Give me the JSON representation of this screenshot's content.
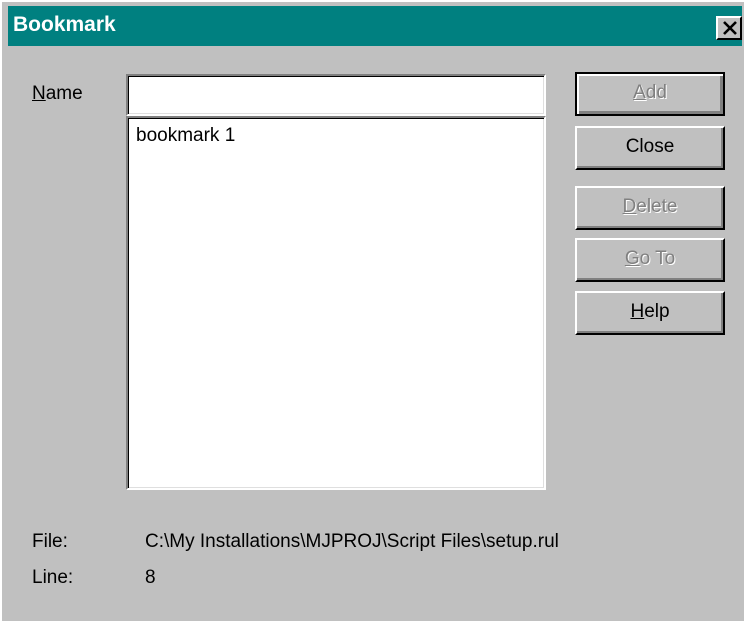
{
  "window": {
    "title": "Bookmark",
    "close_icon": "close-x-icon"
  },
  "form": {
    "name_label_mnemonic": "N",
    "name_label_rest": "ame",
    "name_value": "",
    "bookmarks": [
      "bookmark 1"
    ]
  },
  "buttons": {
    "add": {
      "mnemonic": "A",
      "rest": "dd",
      "enabled": false
    },
    "close": {
      "label": "Close",
      "enabled": true
    },
    "delete": {
      "mnemonic": "D",
      "rest": "elete",
      "enabled": false
    },
    "goto": {
      "mnemonic": "G",
      "rest": "o To",
      "enabled": false
    },
    "help": {
      "mnemonic": "H",
      "rest": "elp",
      "enabled": true
    }
  },
  "info": {
    "file_label": "File:",
    "file_value": "C:\\My Installations\\MJPROJ\\Script Files\\setup.rul",
    "line_label": "Line:",
    "line_value": "8"
  },
  "colors": {
    "titlebar": "#008080",
    "face": "#c0c0c0",
    "disabled_text": "#808080"
  }
}
